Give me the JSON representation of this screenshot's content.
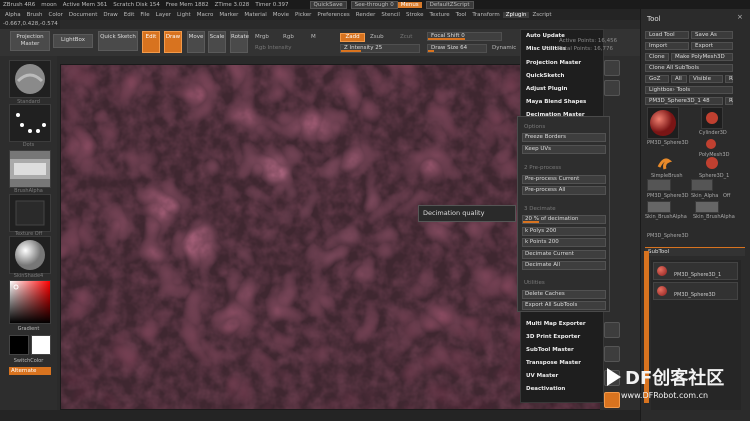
{
  "titlebar": {
    "app": "ZBrush 4R6",
    "doc": "moon",
    "active_mem": "Active Mem 361",
    "scratch_disk": "Scratch Disk 154",
    "free_mem": "Free Mem 1882",
    "ztime": "ZTime 3.028",
    "timer": "Timer 0.397",
    "quicksave": "QuickSave",
    "see_through": "See-through  0",
    "menus": "Menus",
    "default_script": "DefaultZScript"
  },
  "menubar": [
    "Alpha",
    "Brush",
    "Color",
    "Document",
    "Draw",
    "Edit",
    "File",
    "Layer",
    "Light",
    "Macro",
    "Marker",
    "Material",
    "Movie",
    "Picker",
    "Preferences",
    "Render",
    "Stencil",
    "Stroke",
    "Texture",
    "Tool",
    "Transform",
    "Zplugin",
    "Zscript"
  ],
  "menubar_active": "Zplugin",
  "coords": "-0.667,0.428,-0.574",
  "toolbar": {
    "projection_master": "Projection Master",
    "lightbox": "LightBox",
    "quick_sketch": "Quick Sketch",
    "edit": "Edit",
    "draw": "Draw",
    "move": "Move",
    "scale": "Scale",
    "rotate": "Rotate",
    "mrgb": "Mrgb",
    "rgb": "Rgb",
    "m": "M",
    "rgb_intensity": "Rgb Intensity",
    "zadd": "Zadd",
    "zsub": "Zsub",
    "zcut": "Zcut",
    "z_intensity": "Z Intensity 25",
    "focal_shift": "Focal Shift 0",
    "draw_size": "Draw Size 64",
    "dynamic": "Dynamic"
  },
  "leftshelf": {
    "brush_label": "Standard",
    "stroke_label": "Dots",
    "alpha_label": "BrushAlpha",
    "texture_label": "Texture Off",
    "material_label": "SkinShade4",
    "gradient": "Gradient",
    "switch_color": "SwitchColor",
    "alternate": "Alternate"
  },
  "zplugin_menu": {
    "items_top": [
      "Auto Update",
      "Misc Utilities"
    ],
    "stats": [
      "Active Points: 16,456",
      "Total Points: 16,776"
    ],
    "items_mid": [
      "Projection Master",
      "QuickSketch",
      "Adjust Plugin",
      "Maya Blend Shapes",
      "Decimation Master"
    ],
    "items_bottom": [
      "Multi Map Exporter",
      "3D Print Exporter",
      "SubTool Master",
      "Transpose Master",
      "UV Master",
      "Deactivation"
    ]
  },
  "decimation": {
    "options_head": "Options",
    "freeze_borders": "Freeze Borders",
    "keep_uvs": "Keep UVs",
    "preprocess_head": "2 Pre-process",
    "preprocess_current": "Pre-process Current",
    "preprocess_all": "Pre-process All",
    "decimate_head": "3 Decimate",
    "percent": "20 % of decimation",
    "polys": "k Polys 200",
    "points": "k Points 200",
    "decimate_current": "Decimate Current",
    "decimate_all": "Decimate All",
    "utilities_head": "Utilities",
    "delete_caches": "Delete Caches",
    "export_all": "Export All SubTools"
  },
  "tooltip": "Decimation quality",
  "toolpanel": {
    "title": "Tool",
    "load_tool": "Load Tool",
    "save_as": "Save As",
    "import": "Import",
    "export": "Export",
    "clone": "Clone",
    "make_polymesh": "Make PolyMesh3D",
    "clone_all": "Clone All SubTools",
    "goz": "GoZ",
    "all": "All",
    "visible": "Visible",
    "r": "R",
    "lightbox_tools": "Lightbox› Tools",
    "current_tool": "PM3D_Sphere3D_1 48",
    "tools": [
      "PM3D_Sphere3D",
      "Cylinder3D",
      "PolyMesh3D",
      "SimpleBrush",
      "Sphere3D_1",
      "PM3D_Sphere3D",
      "Skin_Alpha",
      "Skin_BrushAlpha",
      "Skin_BrushAlpha",
      "PM3D_Sphere3D"
    ],
    "alpha_off": "Off",
    "subtool_head": "SubTool",
    "subtools": [
      "PM3D_Sphere3D_1",
      "PM3D_Sphere3D"
    ]
  },
  "watermark": {
    "title": "DF创客社区",
    "url": "www.DFRobot.com.cn"
  },
  "colors": {
    "accent": "#d8731f",
    "viewport": "#6b3d4d",
    "panel": "#2b2b2b"
  },
  "icons": {
    "brush": "sphere-brush-icon",
    "stroke": "dots-stroke-icon",
    "alpha": "alpha-icon",
    "texture": "texture-icon",
    "material": "material-sphere-icon",
    "color_picker": "color-picker-icon"
  },
  "sliders": {
    "z_intensity_pct": 25,
    "focal_shift_pct": 50,
    "draw_size_pct": 10,
    "decimation_pct": 20
  }
}
